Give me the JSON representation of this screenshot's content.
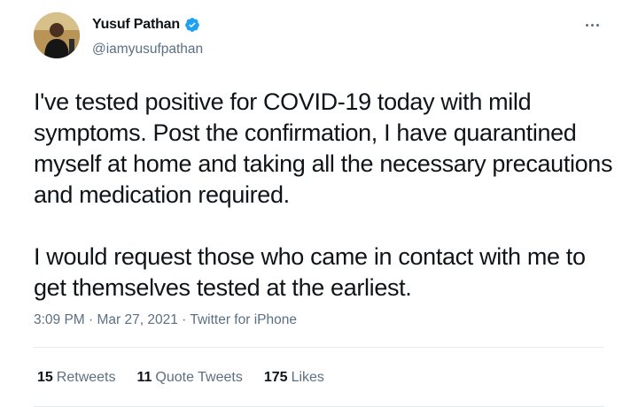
{
  "author": {
    "display_name": "Yusuf Pathan",
    "handle": "@iamyusufpathan",
    "verified": true,
    "verified_color": "#1da1f2"
  },
  "tweet": {
    "paragraphs": [
      "I've tested positive for COVID-19 today with mild symptoms. Post the confirmation, I have quarantined myself at home and taking all the necessary precautions and medication required.",
      "I would request those who came in contact with me to get themselves tested at the earliest."
    ]
  },
  "meta": {
    "time": "3:09 PM",
    "separator": " · ",
    "date": "Mar 27, 2021",
    "source": "Twitter for iPhone"
  },
  "stats": {
    "retweets_count": "15",
    "retweets_label": "Retweets",
    "quotes_count": "11",
    "quotes_label": "Quote Tweets",
    "likes_count": "175",
    "likes_label": "Likes"
  },
  "colors": {
    "text_primary": "#0f1419",
    "text_secondary": "#5b7083",
    "divider": "#e6ecf0"
  },
  "icons": {
    "verified": "verified-badge-icon",
    "more": "more-options-icon"
  }
}
